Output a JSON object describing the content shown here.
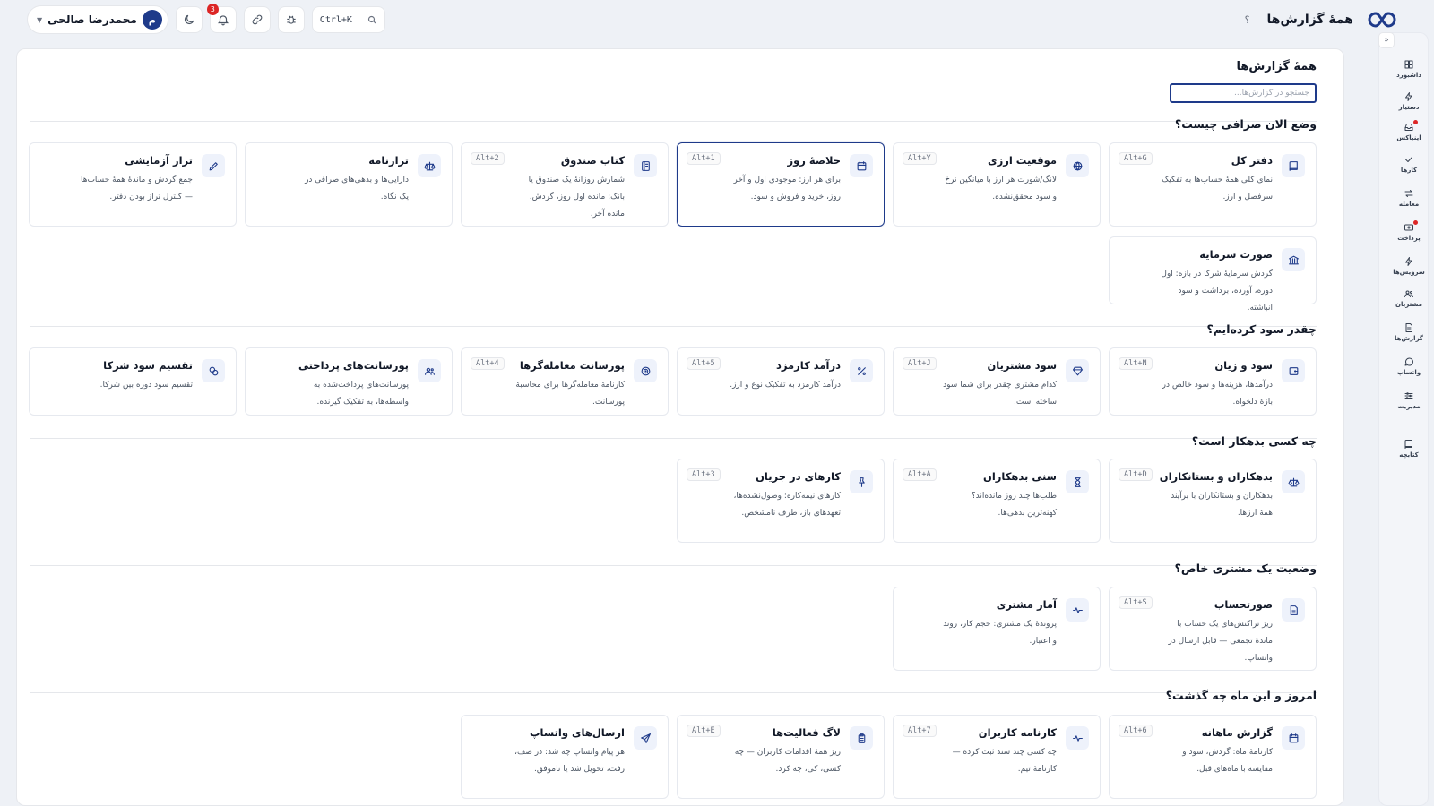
{
  "header": {
    "title": "همهٔ گزارش‌ها",
    "help": "؟",
    "search_shortcut": "Ctrl+K",
    "notifications_count": "3",
    "user_name": "محمدرضا صالحی",
    "user_initial": "م"
  },
  "rail": {
    "collapse": "«",
    "items": [
      {
        "label": "داشبورد",
        "icon": "dashboard-icon"
      },
      {
        "label": "دستیار",
        "icon": "bolt-icon"
      },
      {
        "label": "اینباکس",
        "icon": "inbox-icon",
        "dot": true
      },
      {
        "label": "کارها",
        "icon": "check-icon"
      },
      {
        "label": "معامله",
        "icon": "exchange-icon"
      },
      {
        "label": "پرداخت",
        "icon": "payment-icon",
        "dot": true
      },
      {
        "label": "سرویس‌ها",
        "icon": "bolt-icon"
      },
      {
        "label": "مشتریان",
        "icon": "users-icon"
      },
      {
        "label": "گزارش‌ها",
        "icon": "report-icon"
      },
      {
        "label": "واتساپ",
        "icon": "chat-icon"
      },
      {
        "label": "مدیریت",
        "icon": "sliders-icon"
      },
      {
        "label": "کتابچه",
        "icon": "book-icon"
      }
    ]
  },
  "main": {
    "title": "همهٔ گزارش‌ها",
    "search_placeholder": "جستجو در گزارش‌ها...",
    "sections": [
      {
        "title": "وضع الان صرافی چیست؟"
      },
      {
        "title": "چقدر سود کرده‌ایم؟"
      },
      {
        "title": "چه کسی بدهکار است؟"
      },
      {
        "title": "وضعیت یک مشتری خاص؟"
      },
      {
        "title": "امروز و این ماه چه گذشت؟"
      }
    ],
    "cards": [
      {
        "title": "دفتر کل",
        "desc": "نمای کلی همهٔ حساب‌ها به تفکیک سرفصل و ارز.",
        "key": "Alt+G",
        "icon": "book-icon"
      },
      {
        "title": "موقعیت ارزی",
        "desc": "لانگ/شورت هر ارز با میانگین نرخ و سود محقق‌نشده.",
        "key": "Alt+Y",
        "icon": "globe-icon"
      },
      {
        "title": "خلاصهٔ روز",
        "desc": "برای هر ارز: موجودی اول و آخر روز، خرید و فروش و سود.",
        "key": "Alt+1",
        "icon": "calendar-icon"
      },
      {
        "title": "کتاب صندوق",
        "desc": "شمارش روزانهٔ یک صندوق یا بانک: مانده اول روز، گردش، مانده آخر.",
        "key": "Alt+2",
        "icon": "ledger-icon"
      },
      {
        "title": "ترازنامه",
        "desc": "دارایی‌ها و بدهی‌های صرافی در یک نگاه.",
        "key": "",
        "icon": "scale-icon"
      },
      {
        "title": "تراز آزمایشی",
        "desc": "جمع گردش و ماندهٔ همهٔ حساب‌ها — کنترل تراز بودن دفتر.",
        "key": "",
        "icon": "pencil-icon"
      },
      {
        "title": "صورت سرمایه",
        "desc": "گردش سرمایهٔ شرکا در بازه: اول دوره، آورده، برداشت و سود انباشته.",
        "key": "",
        "icon": "bank-icon"
      },
      {
        "title": "سود و زیان",
        "desc": "درآمدها، هزینه‌ها و سود خالص در بازهٔ دلخواه.",
        "key": "Alt+N",
        "icon": "wallet-icon"
      },
      {
        "title": "سود مشتریان",
        "desc": "کدام مشتری چقدر برای شما سود ساخته است.",
        "key": "Alt+J",
        "icon": "diamond-icon"
      },
      {
        "title": "درآمد کارمزد",
        "desc": "درآمد کارمزد به تفکیک نوع و ارز.",
        "key": "Alt+5",
        "icon": "percent-icon"
      },
      {
        "title": "پورسانت معامله‌گرها",
        "desc": "کارنامهٔ معامله‌گرها برای محاسبهٔ پورسانت.",
        "key": "Alt+4",
        "icon": "target-icon"
      },
      {
        "title": "پورسانت‌های پرداختی",
        "desc": "پورسانت‌های پرداخت‌شده به واسطه‌ها، به تفکیک گیرنده.",
        "key": "",
        "icon": "users-icon"
      },
      {
        "title": "تقسیم سود شرکا",
        "desc": "تقسیم سود دوره بین شرکا.",
        "key": "",
        "icon": "coins-icon"
      },
      {
        "title": "بدهکاران و بستانکاران",
        "desc": "بدهکاران و بستانکاران با برآیند همهٔ ارزها.",
        "key": "Alt+D",
        "icon": "scale-icon"
      },
      {
        "title": "سنی بدهکاران",
        "desc": "طلب‌ها چند روز مانده‌اند؟ کهنه‌ترین بدهی‌ها.",
        "key": "Alt+A",
        "icon": "hourglass-icon"
      },
      {
        "title": "کارهای در جریان",
        "desc": "کارهای نیمه‌کاره: وصول‌نشده‌ها، تعهدهای باز، طرف نامشخص.",
        "key": "Alt+3",
        "icon": "pin-icon"
      },
      {
        "title": "صورتحساب",
        "desc": "ریز تراکنش‌های یک حساب با ماندهٔ تجمعی — قابل ارسال در واتساپ.",
        "key": "Alt+S",
        "icon": "document-icon"
      },
      {
        "title": "آمار مشتری",
        "desc": "پروندهٔ یک مشتری: حجم کار، روند و اعتبار.",
        "key": "",
        "icon": "pulse-icon"
      },
      {
        "title": "گزارش ماهانه",
        "desc": "کارنامهٔ ماه: گردش، سود و مقایسه با ماه‌های قبل.",
        "key": "Alt+6",
        "icon": "calendar-icon"
      },
      {
        "title": "کارنامه کاربران",
        "desc": "چه کسی چند سند ثبت کرده — کارنامهٔ تیم.",
        "key": "Alt+7",
        "icon": "pulse-icon"
      },
      {
        "title": "لاگ فعالیت‌ها",
        "desc": "ریز همهٔ اقدامات کاربران — چه کسی، کی، چه کرد.",
        "key": "Alt+E",
        "icon": "clipboard-icon"
      },
      {
        "title": "ارسال‌های واتساپ",
        "desc": "هر پیام واتساپ چه شد: در صف، رفت، تحویل شد یا ناموفق.",
        "key": "",
        "icon": "send-icon"
      }
    ]
  }
}
